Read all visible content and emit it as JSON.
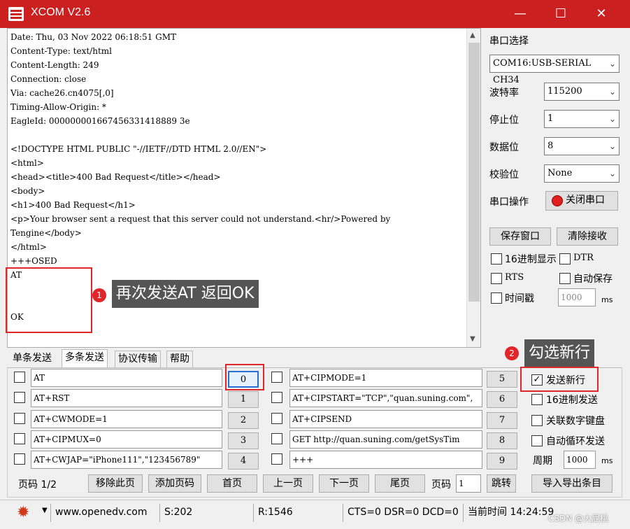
{
  "window": {
    "title": "XCOM V2.6",
    "minimize": "—",
    "maximize": "☐",
    "close": "✕"
  },
  "receive_lines": [
    "Date: Thu, 03 Nov 2022 06:18:51 GMT",
    "Content-Type: text/html",
    "Content-Length: 249",
    "Connection: close",
    "Via: cache26.cn4075[,0]",
    "Timing-Allow-Origin: *",
    "EagleId: 000000001667456331418889 3e",
    "",
    "<!DOCTYPE HTML PUBLIC \"-//IETF//DTD HTML 2.0//EN\">",
    "<html>",
    "<head><title>400 Bad Request</title></head>",
    "<body>",
    "<h1>400 Bad Request</h1>",
    "<p>Your browser sent a request that this server could not understand.<hr/>Powered by",
    "Tengine</body>",
    "</html>",
    "+++OSED",
    "AT",
    "",
    "",
    "OK"
  ],
  "settings": {
    "port_select_label": "串口选择",
    "port_value": "COM16:USB-SERIAL CH34",
    "baud_label": "波特率",
    "baud_value": "115200",
    "stop_label": "停止位",
    "stop_value": "1",
    "data_label": "数据位",
    "data_value": "8",
    "parity_label": "校验位",
    "parity_value": "None",
    "port_op_label": "串口操作",
    "close_port_button": "关闭串口",
    "save_window_button": "保存窗口",
    "clear_recv_button": "清除接收",
    "hex_display_label": "16进制显示",
    "dtr_label": "DTR",
    "rts_label": "RTS",
    "auto_save_label": "自动保存",
    "timestamp_label": "时间戳",
    "timestamp_value": "1000",
    "timestamp_unit": "ms"
  },
  "tabs": [
    "单条发送",
    "多条发送",
    "协议传输",
    "帮助"
  ],
  "multi_send": {
    "left_rows": [
      {
        "text": "AT",
        "num": "0"
      },
      {
        "text": "AT+RST",
        "num": "1"
      },
      {
        "text": "AT+CWMODE=1",
        "num": "2"
      },
      {
        "text": "AT+CIPMUX=0",
        "num": "3"
      },
      {
        "text": "AT+CWJAP=\"iPhone111\",\"123456789\"",
        "num": "4"
      }
    ],
    "right_rows": [
      {
        "text": "AT+CIPMODE=1",
        "num": "5"
      },
      {
        "text": "AT+CIPSTART=\"TCP\",\"quan.suning.com\",",
        "num": "6"
      },
      {
        "text": "AT+CIPSEND",
        "num": "7"
      },
      {
        "text": "GET http://quan.suning.com/getSysTim",
        "num": "8"
      },
      {
        "text": "+++",
        "num": "9"
      }
    ],
    "send_newline_label": "发送新行",
    "hex_send_label": "16进制发送",
    "link_keypad_label": "关联数字键盘",
    "auto_loop_label": "自动循环发送",
    "period_label": "周期",
    "period_value": "1000",
    "period_unit": "ms"
  },
  "pager": {
    "page_info": "页码 1/2",
    "remove_page": "移除此页",
    "add_page": "添加页码",
    "first_page": "首页",
    "prev_page": "上一页",
    "next_page": "下一页",
    "last_page": "尾页",
    "page_label": "页码",
    "page_value": "1",
    "jump": "跳转",
    "import_export": "导入导出条目"
  },
  "statusbar": {
    "website": "www.openedv.com",
    "sent": "S:202",
    "received": "R:1546",
    "signals": "CTS=0 DSR=0 DCD=0",
    "time": "当前时间 14:24:59"
  },
  "annotations": {
    "badge1": "1",
    "tip1": "再次发送AT  返回OK",
    "badge2": "2",
    "tip2": "勾选新行"
  },
  "watermark": "CSDN @大屁桃"
}
